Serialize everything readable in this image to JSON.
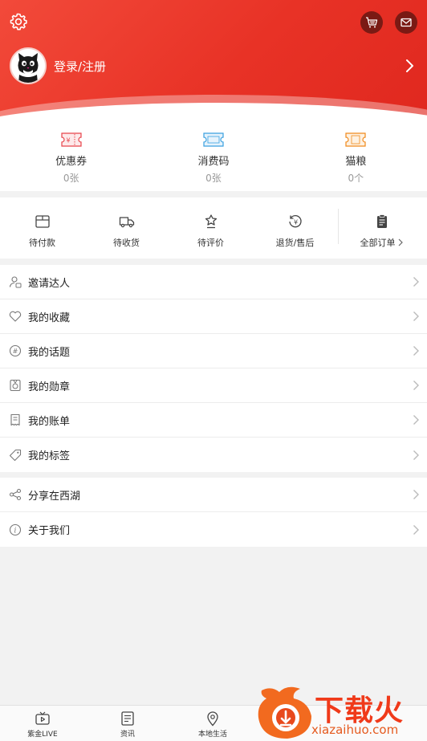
{
  "header": {
    "login_label": "登录/注册"
  },
  "coupons": [
    {
      "icon": "coupon-ticket-icon",
      "title": "优惠券",
      "value": "0张",
      "color": "#e8434a"
    },
    {
      "icon": "consume-code-icon",
      "title": "消费码",
      "value": "0张",
      "color": "#3aa0e0"
    },
    {
      "icon": "cat-food-icon",
      "title": "猫粮",
      "value": "0个",
      "color": "#f08a1c"
    }
  ],
  "orders": [
    {
      "icon": "pending-payment-icon",
      "label": "待付款"
    },
    {
      "icon": "pending-receipt-icon",
      "label": "待收货"
    },
    {
      "icon": "pending-review-icon",
      "label": "待评价"
    },
    {
      "icon": "refund-icon",
      "label": "退货/售后"
    },
    {
      "icon": "all-orders-icon",
      "label": "全部订单"
    }
  ],
  "menu_group_1": [
    {
      "icon": "invite-icon",
      "label": "邀请达人"
    },
    {
      "icon": "heart-icon",
      "label": "我的收藏"
    },
    {
      "icon": "hashtag-icon",
      "label": "我的话题"
    },
    {
      "icon": "medal-icon",
      "label": "我的勋章"
    },
    {
      "icon": "bill-icon",
      "label": "我的账单"
    },
    {
      "icon": "tag-icon",
      "label": "我的标签"
    }
  ],
  "menu_group_2": [
    {
      "icon": "share-icon",
      "label": "分享在西湖"
    },
    {
      "icon": "info-icon",
      "label": "关于我们"
    }
  ],
  "bottom_nav": [
    {
      "icon": "tv-icon",
      "label": "紫金LIVE"
    },
    {
      "icon": "news-icon",
      "label": "资讯"
    },
    {
      "icon": "location-icon",
      "label": "本地生活"
    }
  ],
  "watermark": {
    "text": "下载火",
    "url": "xiazaihuo.com"
  },
  "colors": {
    "brand_red": "#e83226",
    "text_primary": "#222222",
    "text_muted": "#999999"
  }
}
